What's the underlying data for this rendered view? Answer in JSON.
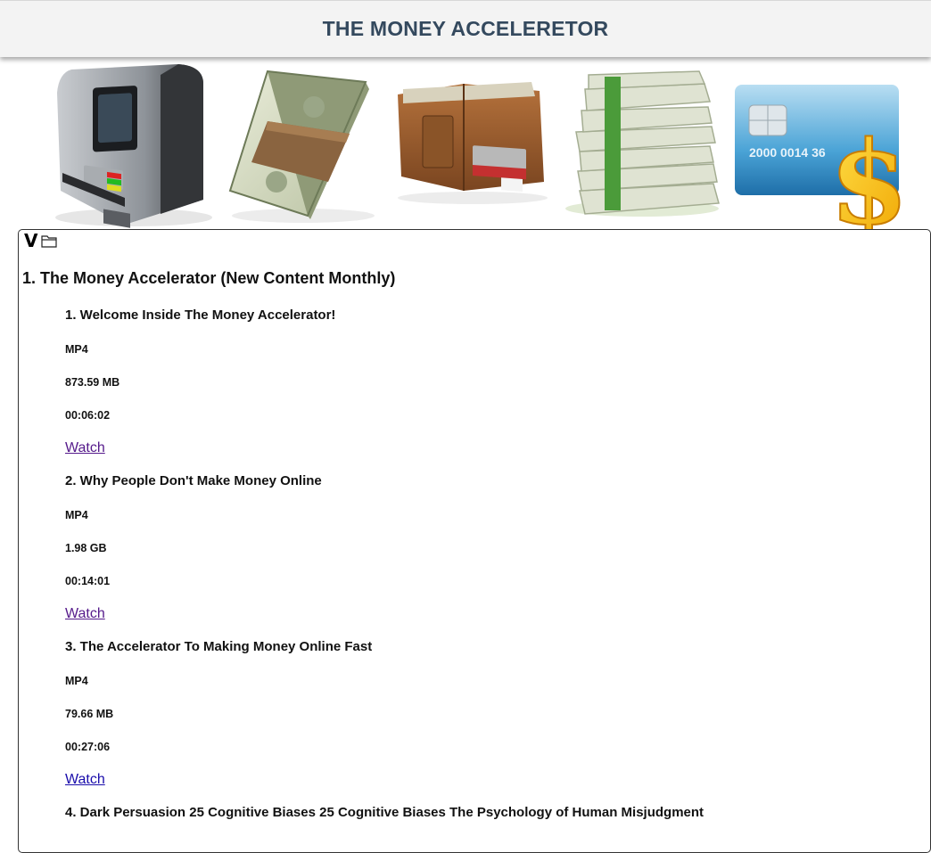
{
  "header": {
    "title": "THE MONEY ACCELERETOR"
  },
  "banner": {
    "images": [
      "atm-icon",
      "cash-bundle-icon",
      "wallet-icon",
      "cash-stack-icon",
      "credit-card-dollar-icon"
    ],
    "card_number_text": "2000 0014 36"
  },
  "panel": {
    "toggle_glyph": "V",
    "section_title": "1. The Money Accelerator (New Content Monthly)",
    "items": [
      {
        "title": "1. Welcome Inside The Money Accelerator!",
        "format": "MP4",
        "size": "873.59 MB",
        "duration": "00:06:02",
        "link": "Watch"
      },
      {
        "title": "2. Why People Don't Make Money Online",
        "format": "MP4",
        "size": "1.98 GB",
        "duration": "00:14:01",
        "link": "Watch"
      },
      {
        "title": "3. The Accelerator To Making Money Online Fast",
        "format": "MP4",
        "size": "79.66 MB",
        "duration": "00:27:06",
        "link": "Watch"
      },
      {
        "title": "4. Dark Persuasion 25 Cognitive Biases 25 Cognitive Biases The Psychology of Human Misjudgment"
      }
    ]
  },
  "colors": {
    "header_bg": "#f3f3f3",
    "title": "#34495e",
    "visited_link": "#551a8b",
    "link": "#1a0dab"
  }
}
